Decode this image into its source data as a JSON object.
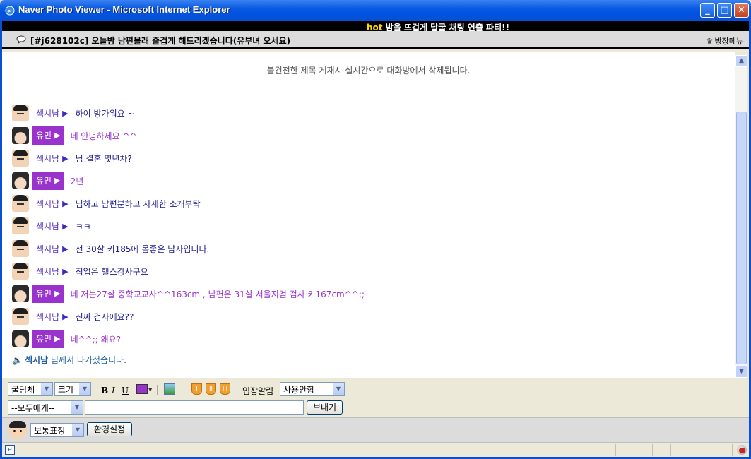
{
  "window": {
    "title": "Naver Photo Viewer - Microsoft Internet Explorer",
    "min_label": "_",
    "max_label": "□",
    "close_label": "✕"
  },
  "banner": {
    "hot_prefix": "hot",
    "hot_text": " 밤을 뜨겁게 달굴 채팅 연출 파티!!"
  },
  "room": {
    "title": "[#j628102c] 오늘밤 남편몰래 즐겁게 해드리겠습니다(유부녀 오세요)",
    "menu_label": "방장메뉴"
  },
  "chat": {
    "notice": "불건전한 제목 게재시 실시간으로 대화방에서 삭제됩니다.",
    "messages": [
      {
        "gender": "male",
        "nick": "섹시남",
        "text": "하이 방가워요 ~"
      },
      {
        "gender": "female",
        "nick": "유민",
        "text": "네 안녕하세요 ^^"
      },
      {
        "gender": "male",
        "nick": "섹시남",
        "text": "님 결혼 몇년차?"
      },
      {
        "gender": "female",
        "nick": "유민",
        "text": "2년"
      },
      {
        "gender": "male",
        "nick": "섹시남",
        "text": "님하고 남편분하고 자세한 소개부탁"
      },
      {
        "gender": "male",
        "nick": "섹시남",
        "text": "ㅋㅋ"
      },
      {
        "gender": "male",
        "nick": "섹시남",
        "text": "전 30살 키185에 몸좋은 남자입니다."
      },
      {
        "gender": "male",
        "nick": "섹시남",
        "text": "직업은 헬스강사구요"
      },
      {
        "gender": "female",
        "nick": "유민",
        "text": "네 저는27살 중학교교사^^163cm , 남편은 31살 서울지검 검사 키167cm^^;;"
      },
      {
        "gender": "male",
        "nick": "섹시남",
        "text": "진짜 검사에요??"
      },
      {
        "gender": "female",
        "nick": "유민",
        "text": "네^^;; 왜요?"
      }
    ],
    "leave_nick": "섹시남",
    "leave_text": " 님께서 나가셨습니다."
  },
  "toolbar": {
    "font_select": "굴림체",
    "size_select": "크기",
    "bold_label": "B",
    "italic_label": "I",
    "underline_label": "U",
    "emo1": "I",
    "emo2": "II",
    "emo3": "III",
    "entry_alert_label": "입장알림",
    "entry_alert_select": "사용안함",
    "target_select": "--모두에게--",
    "message_value": "",
    "send_label": "보내기"
  },
  "bottom": {
    "expression_select": "보통표정",
    "settings_label": "환경설정"
  },
  "colors": {
    "accent_male": "#1A1A8C",
    "accent_female": "#9933CC",
    "selected_text_color": "#9933CC"
  }
}
